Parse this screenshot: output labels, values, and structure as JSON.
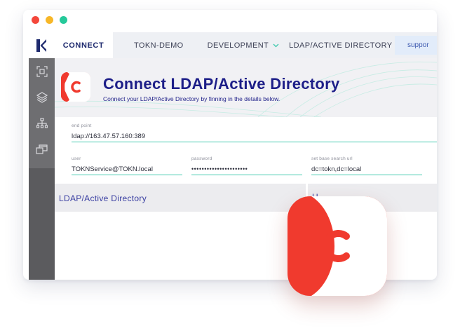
{
  "window": {
    "controls": [
      "close",
      "minimize",
      "maximize"
    ]
  },
  "appbar": {
    "logo_icon": "k-logo-icon",
    "brand": "CONNECT",
    "tabs": [
      {
        "label": "TOKN-DEMO",
        "has_dropdown": false
      },
      {
        "label": "DEVELOPMENT",
        "has_dropdown": true
      },
      {
        "label": "LDAP/ACTIVE DIRECTORY",
        "has_dropdown": true
      }
    ],
    "support_label": "suppor"
  },
  "sidebar": {
    "items": [
      {
        "icon": "frame-scan-icon"
      },
      {
        "icon": "layers-icon"
      },
      {
        "icon": "hierarchy-icon"
      },
      {
        "icon": "windows-icon"
      }
    ]
  },
  "hero": {
    "title": "Connect LDAP/Active Directory",
    "subtitle": "Connect your LDAP/Active Directory by finning in the details below."
  },
  "form": {
    "end_point": {
      "label": "end point",
      "value": "ldap://163.47.57.160:389"
    },
    "user": {
      "label": "user",
      "value": "TOKNService@TOKN.local"
    },
    "password": {
      "label": "password",
      "value": "••••••••••••••••••••••"
    },
    "search_url": {
      "label": "set base search url",
      "value": "dc=tokn,dc=local"
    }
  },
  "panels": {
    "left_label": "LDAP/Active Directory",
    "right_label": "U"
  },
  "colors": {
    "brand_red": "#f03a2e",
    "navy": "#1d1e88",
    "teal": "#45cbb0",
    "sidebar": "#5b5b5e"
  }
}
